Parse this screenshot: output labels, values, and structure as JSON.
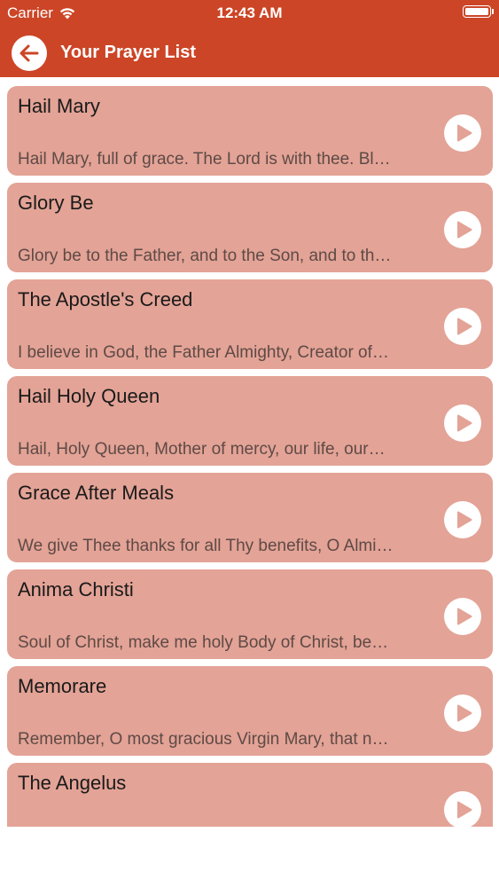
{
  "status_bar": {
    "carrier": "Carrier",
    "time": "12:43 AM",
    "wifi_icon": "wifi-icon",
    "battery_icon": "battery-icon"
  },
  "nav": {
    "title": "Your Prayer List",
    "back_icon": "arrow-left-icon"
  },
  "colors": {
    "header": "#cc4526",
    "card": "#e3a396",
    "text": "#1a1a1a",
    "excerpt": "#5e4a46"
  },
  "prayers": [
    {
      "title": "Hail Mary",
      "excerpt": "Hail Mary, full of grace. The Lord is with thee. Bl…"
    },
    {
      "title": "Glory Be",
      "excerpt": "Glory be to the Father, and to the Son, and to th…"
    },
    {
      "title": "The Apostle's Creed",
      "excerpt": "I believe in God, the Father Almighty, Creator of…"
    },
    {
      "title": "Hail Holy Queen",
      "excerpt": "Hail, Holy Queen, Mother of mercy, our life, our…"
    },
    {
      "title": "Grace After Meals",
      "excerpt": "We give Thee thanks for all Thy benefits, O Almi…"
    },
    {
      "title": "Anima Christi",
      "excerpt": "Soul of Christ, make me holy Body of Christ, be…"
    },
    {
      "title": "Memorare",
      "excerpt": "Remember, O most gracious Virgin Mary, that n…"
    },
    {
      "title": "The Angelus",
      "excerpt": ""
    }
  ]
}
